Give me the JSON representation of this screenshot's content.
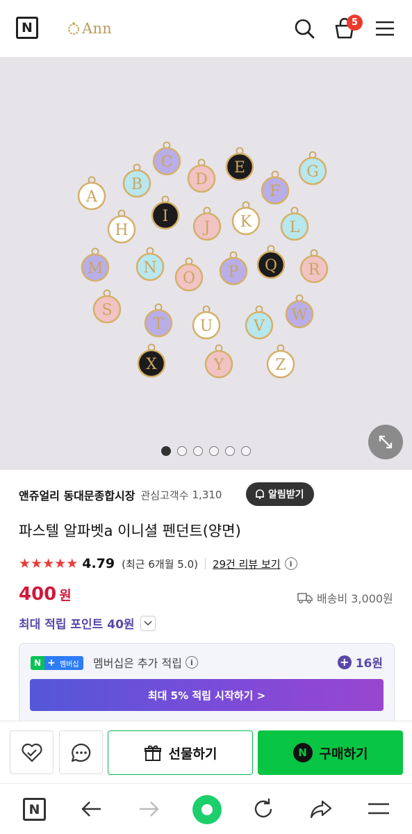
{
  "header": {
    "naver_logo_letter": "N",
    "brand_name": "Ann",
    "cart_count": "5"
  },
  "gallery": {
    "letters": [
      "A",
      "B",
      "C",
      "D",
      "E",
      "F",
      "G",
      "H",
      "I",
      "J",
      "K",
      "L",
      "M",
      "N",
      "O",
      "P",
      "Q",
      "R",
      "S",
      "T",
      "U",
      "V",
      "W",
      "X",
      "Y",
      "Z"
    ],
    "page_count": 6,
    "active_page": 0
  },
  "store": {
    "name": "앤쥬얼리 동대문종합시장",
    "follow_label": "관심고객수",
    "follow_count": "1,310",
    "notify_label": "알림받기"
  },
  "product": {
    "title": "파스텔 알파벳a 이니셜 펜던트(양면)",
    "rating": "4.79",
    "rating_recent": "(최근 6개월 5.0)",
    "review_link": "29건 리뷰 보기",
    "star_count": 5,
    "price": "400",
    "price_unit": "원",
    "shipping": "배송비 3,000원",
    "points": "최대 적립 포인트 40원"
  },
  "membership": {
    "badge_label": "멤버십",
    "text": "멤버십은 추가 적립",
    "points": "16원",
    "cta": "최대 5% 적립 시작하기 >"
  },
  "actions": {
    "gift": "선물하기",
    "buy": "구매하기",
    "npay_letter": "N"
  },
  "browser": {
    "naver_letter": "N"
  },
  "colors": {
    "price_red": "#d1183a",
    "point_purple": "#5a47a8",
    "buy_green": "#08c543",
    "badge_red": "#ee3a2e"
  }
}
